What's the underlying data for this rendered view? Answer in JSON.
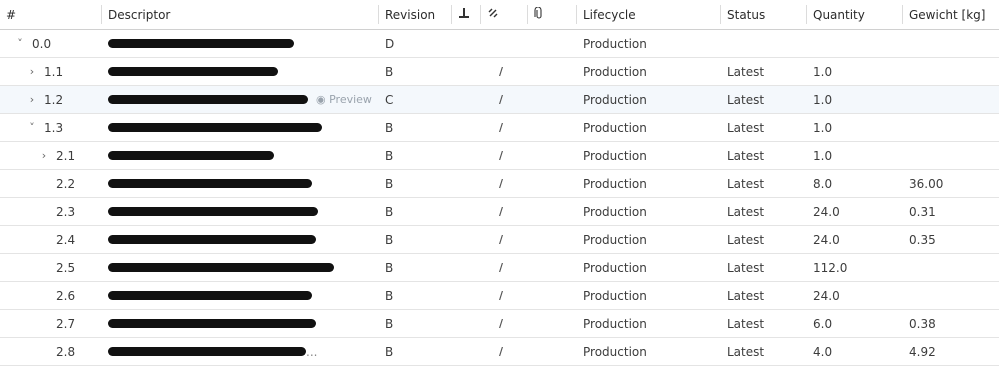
{
  "columns": {
    "num": "#",
    "descriptor": "Descriptor",
    "revision": "Revision",
    "icon1": "pin-icon",
    "icon2": "link-icon",
    "icon3": "attachment-icon",
    "lifecycle": "Lifecycle",
    "status": "Status",
    "quantity": "Quantity",
    "gewicht": "Gewicht [kg]"
  },
  "rows": [
    {
      "num": "0.0",
      "expander": "v",
      "revision": "D",
      "link": "",
      "lifecycle": "Production",
      "status": "",
      "quantity": "",
      "gewicht": ""
    },
    {
      "num": "1.1",
      "expander": ">",
      "revision": "B",
      "link": "∕",
      "lifecycle": "Production",
      "status": "Latest",
      "quantity": "1.0",
      "gewicht": ""
    },
    {
      "num": "1.2",
      "expander": ">",
      "revision": "C",
      "link": "∕",
      "lifecycle": "Production",
      "status": "Latest",
      "quantity": "1.0",
      "gewicht": "",
      "preview": "Preview"
    },
    {
      "num": "1.3",
      "expander": "v",
      "revision": "B",
      "link": "∕",
      "lifecycle": "Production",
      "status": "Latest",
      "quantity": "1.0",
      "gewicht": ""
    },
    {
      "num": "2.1",
      "expander": ">",
      "revision": "B",
      "link": "∕",
      "lifecycle": "Production",
      "status": "Latest",
      "quantity": "1.0",
      "gewicht": ""
    },
    {
      "num": "2.2",
      "expander": "",
      "revision": "B",
      "link": "∕",
      "lifecycle": "Production",
      "status": "Latest",
      "quantity": "8.0",
      "gewicht": "36.00"
    },
    {
      "num": "2.3",
      "expander": "",
      "revision": "B",
      "link": "∕",
      "lifecycle": "Production",
      "status": "Latest",
      "quantity": "24.0",
      "gewicht": "0.31"
    },
    {
      "num": "2.4",
      "expander": "",
      "revision": "B",
      "link": "∕",
      "lifecycle": "Production",
      "status": "Latest",
      "quantity": "24.0",
      "gewicht": "0.35"
    },
    {
      "num": "2.5",
      "expander": "",
      "revision": "B",
      "link": "∕",
      "lifecycle": "Production",
      "status": "Latest",
      "quantity": "112.0",
      "gewicht": ""
    },
    {
      "num": "2.6",
      "expander": "",
      "revision": "B",
      "link": "∕",
      "lifecycle": "Production",
      "status": "Latest",
      "quantity": "24.0",
      "gewicht": ""
    },
    {
      "num": "2.7",
      "expander": "",
      "revision": "B",
      "link": "∕",
      "lifecycle": "Production",
      "status": "Latest",
      "quantity": "6.0",
      "gewicht": "0.38"
    },
    {
      "num": "2.8",
      "expander": "",
      "revision": "B",
      "link": "∕",
      "lifecycle": "Production",
      "status": "Latest",
      "quantity": "4.0",
      "gewicht": "4.92",
      "desc_suffix": "..."
    }
  ]
}
